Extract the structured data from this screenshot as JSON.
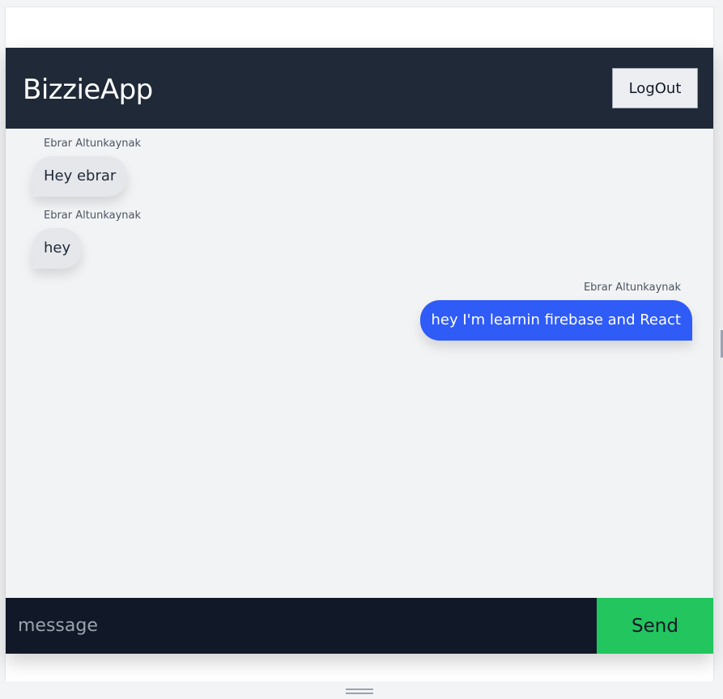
{
  "header": {
    "brand": "BizzieApp",
    "logout_label": "LogOut"
  },
  "messages": [
    {
      "sender": "Ebrar Altunkaynak",
      "text": "Hey ebrar",
      "direction": "received"
    },
    {
      "sender": "Ebrar Altunkaynak",
      "text": "hey",
      "direction": "received"
    },
    {
      "sender": "Ebrar Altunkaynak",
      "text": "hey I'm learnin firebase and React",
      "direction": "sent"
    }
  ],
  "composer": {
    "placeholder": "message",
    "value": "",
    "send_label": "Send"
  },
  "colors": {
    "header_bg": "#1f2937",
    "composer_bg": "#111827",
    "send_bg": "#22c55e",
    "sent_bubble": "#2f5bf7",
    "received_bubble": "#e5e7eb"
  }
}
